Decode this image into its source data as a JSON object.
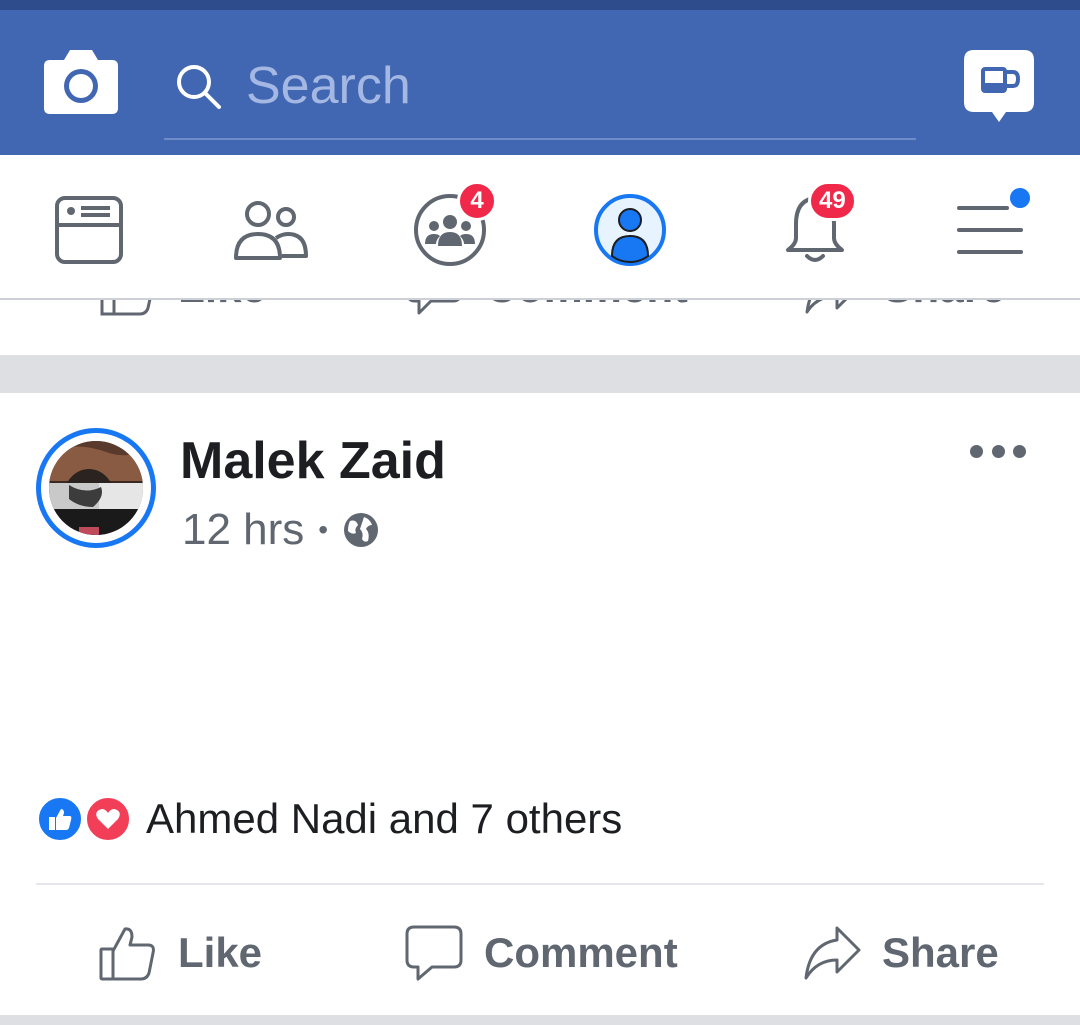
{
  "search": {
    "placeholder": "Search"
  },
  "nav": {
    "groups_badge": "4",
    "notifications_badge": "49"
  },
  "previous_post": {
    "like_label": "Like",
    "comment_label": "Comment",
    "share_label": "Share"
  },
  "post": {
    "author": "Malek Zaid",
    "time": "12 hrs",
    "meta_separator": "•",
    "privacy_icon": "globe-icon",
    "reactions_text": "Ahmed Nadi and 7 others",
    "actions": {
      "like_label": "Like",
      "comment_label": "Comment",
      "share_label": "Share"
    }
  },
  "colors": {
    "brand_blue": "#4267b2",
    "accent_blue": "#1877f2",
    "badge_red": "#f02849",
    "text_primary": "#1c1e21",
    "text_secondary": "#606770"
  }
}
